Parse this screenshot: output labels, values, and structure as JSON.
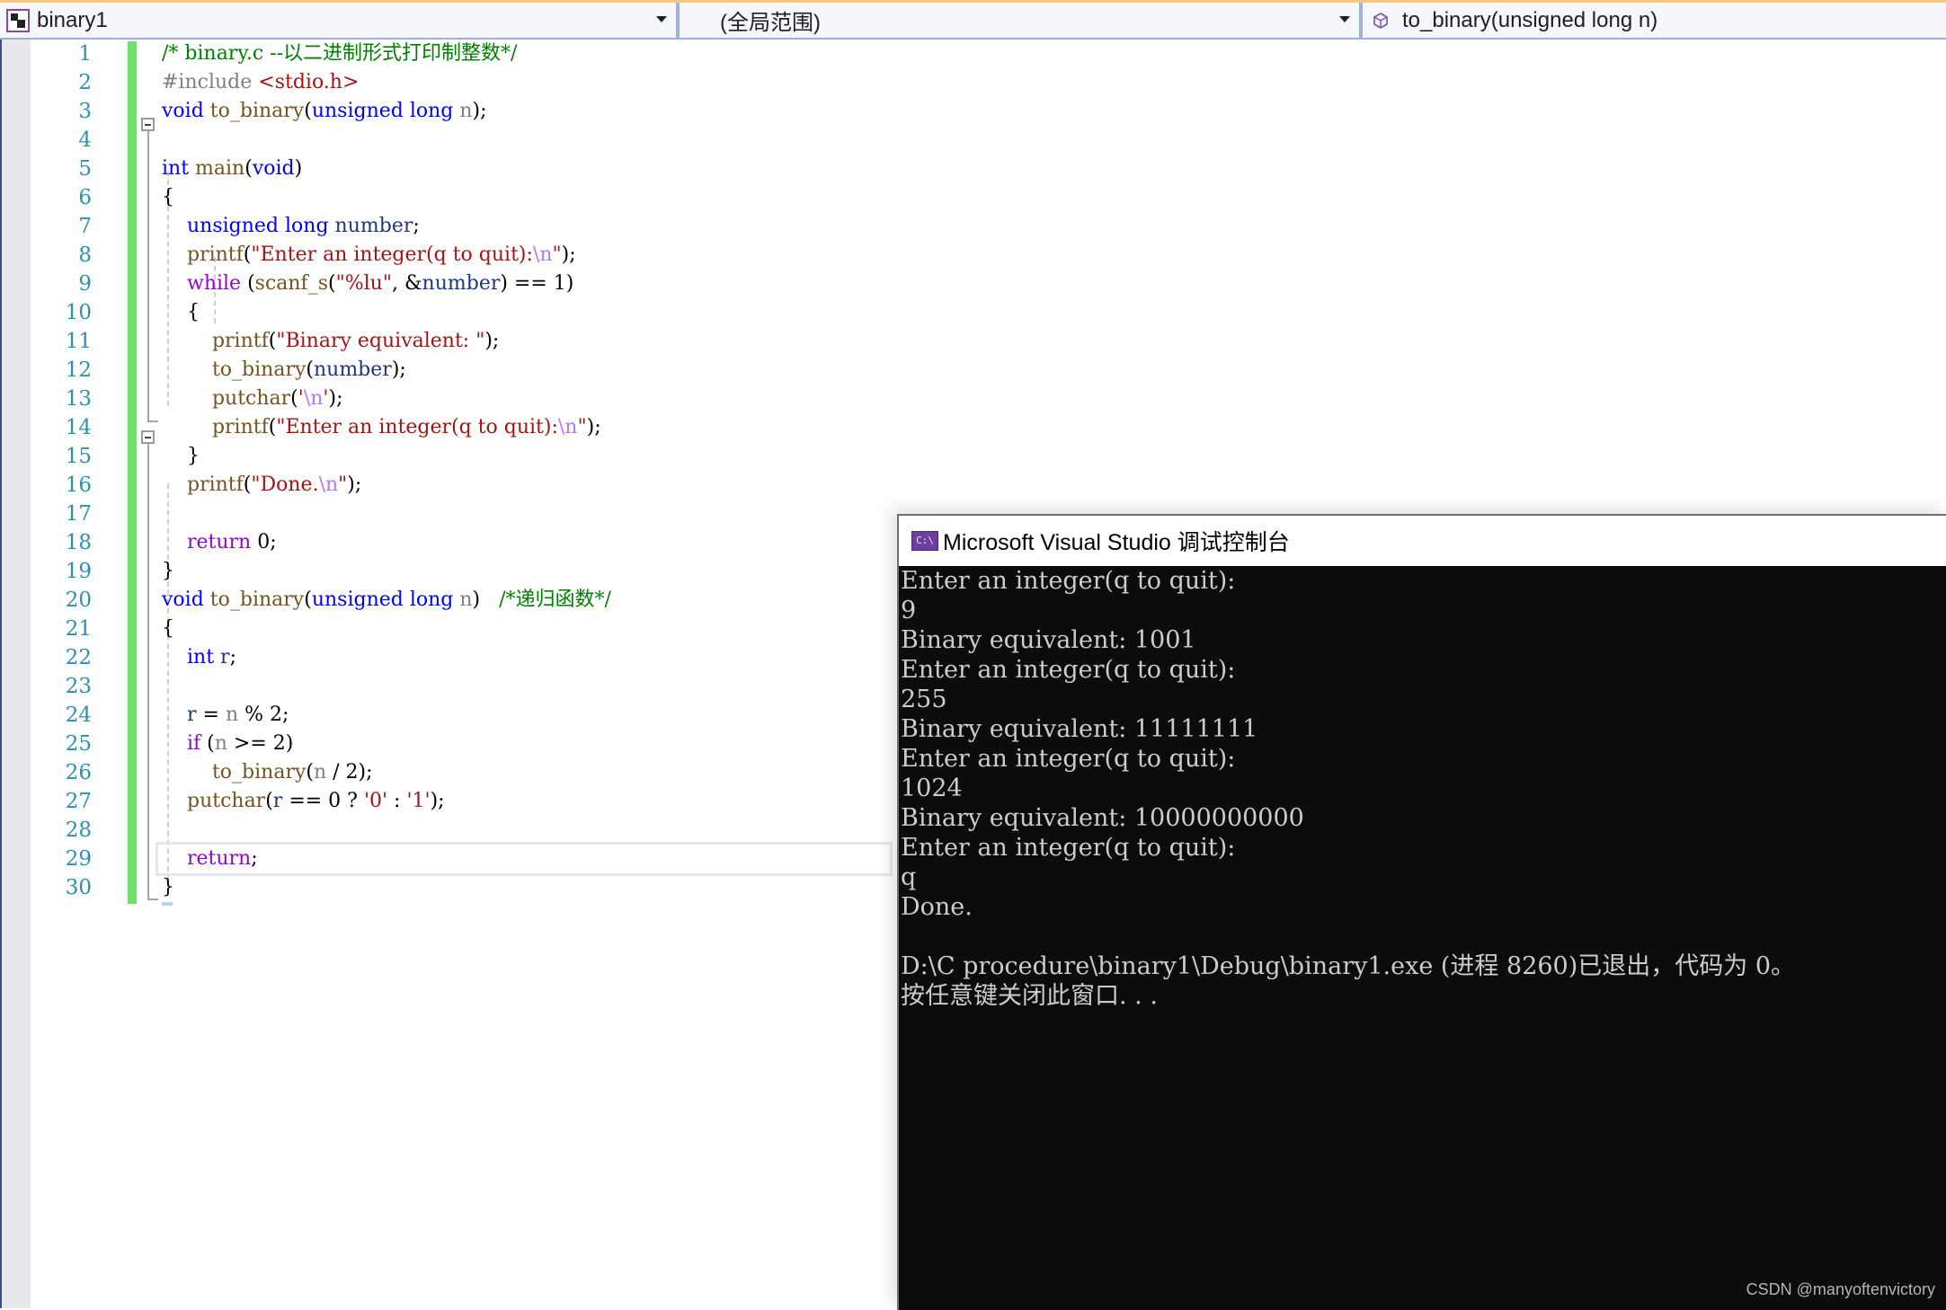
{
  "navbar": {
    "project": "binary1",
    "scope": "(全局范围)",
    "function": "to_binary(unsigned long n)",
    "project_icon": "vc-project-icon",
    "function_icon": "function-cube-icon"
  },
  "editor": {
    "line_numbers": [
      "1",
      "2",
      "3",
      "4",
      "5",
      "6",
      "7",
      "8",
      "9",
      "10",
      "11",
      "12",
      "13",
      "14",
      "15",
      "16",
      "17",
      "18",
      "19",
      "20",
      "21",
      "22",
      "23",
      "24",
      "25",
      "26",
      "27",
      "28",
      "29",
      "30"
    ],
    "current_line": 29,
    "lines": [
      [
        {
          "t": "cmt",
          "v": "/* binary.c --以二进制形式打印制整数*/"
        }
      ],
      [
        {
          "t": "pp",
          "v": "#include "
        },
        {
          "t": "inc",
          "v": "<stdio.h>"
        }
      ],
      [
        {
          "t": "kw",
          "v": "void"
        },
        {
          "t": "",
          "v": " "
        },
        {
          "t": "fn",
          "v": "to_binary"
        },
        {
          "t": "",
          "v": "("
        },
        {
          "t": "kw",
          "v": "unsigned long"
        },
        {
          "t": "",
          "v": " "
        },
        {
          "t": "param",
          "v": "n"
        },
        {
          "t": "",
          "v": ");"
        }
      ],
      [],
      [
        {
          "t": "kw",
          "v": "int"
        },
        {
          "t": "",
          "v": " "
        },
        {
          "t": "fn",
          "v": "main"
        },
        {
          "t": "",
          "v": "("
        },
        {
          "t": "kw",
          "v": "void"
        },
        {
          "t": "",
          "v": ")"
        }
      ],
      [
        {
          "t": "",
          "v": "{"
        }
      ],
      [
        {
          "t": "",
          "v": "    "
        },
        {
          "t": "kw",
          "v": "unsigned long"
        },
        {
          "t": "",
          "v": " "
        },
        {
          "t": "var",
          "v": "number"
        },
        {
          "t": "",
          "v": ";"
        }
      ],
      [
        {
          "t": "",
          "v": "    "
        },
        {
          "t": "fn",
          "v": "printf"
        },
        {
          "t": "",
          "v": "("
        },
        {
          "t": "str",
          "v": "\"Enter an integer(q to quit):"
        },
        {
          "t": "esc",
          "v": "\\n"
        },
        {
          "t": "str",
          "v": "\""
        },
        {
          "t": "",
          "v": ");"
        }
      ],
      [
        {
          "t": "",
          "v": "    "
        },
        {
          "t": "ctl",
          "v": "while"
        },
        {
          "t": "",
          "v": " ("
        },
        {
          "t": "fn",
          "v": "scanf_s"
        },
        {
          "t": "",
          "v": "("
        },
        {
          "t": "str",
          "v": "\"%lu\""
        },
        {
          "t": "",
          "v": ", &"
        },
        {
          "t": "var",
          "v": "number"
        },
        {
          "t": "",
          "v": ") == 1)"
        }
      ],
      [
        {
          "t": "",
          "v": "    {"
        }
      ],
      [
        {
          "t": "",
          "v": "        "
        },
        {
          "t": "fn",
          "v": "printf"
        },
        {
          "t": "",
          "v": "("
        },
        {
          "t": "str",
          "v": "\"Binary equivalent: \""
        },
        {
          "t": "",
          "v": ");"
        }
      ],
      [
        {
          "t": "",
          "v": "        "
        },
        {
          "t": "fn",
          "v": "to_binary"
        },
        {
          "t": "",
          "v": "("
        },
        {
          "t": "var",
          "v": "number"
        },
        {
          "t": "",
          "v": ");"
        }
      ],
      [
        {
          "t": "",
          "v": "        "
        },
        {
          "t": "fn",
          "v": "putchar"
        },
        {
          "t": "",
          "v": "("
        },
        {
          "t": "str",
          "v": "'"
        },
        {
          "t": "esc",
          "v": "\\n"
        },
        {
          "t": "str",
          "v": "'"
        },
        {
          "t": "",
          "v": ");"
        }
      ],
      [
        {
          "t": "",
          "v": "        "
        },
        {
          "t": "fn",
          "v": "printf"
        },
        {
          "t": "",
          "v": "("
        },
        {
          "t": "str",
          "v": "\"Enter an integer(q to quit):"
        },
        {
          "t": "esc",
          "v": "\\n"
        },
        {
          "t": "str",
          "v": "\""
        },
        {
          "t": "",
          "v": ");"
        }
      ],
      [
        {
          "t": "",
          "v": "    }"
        }
      ],
      [
        {
          "t": "",
          "v": "    "
        },
        {
          "t": "fn",
          "v": "printf"
        },
        {
          "t": "",
          "v": "("
        },
        {
          "t": "str",
          "v": "\"Done."
        },
        {
          "t": "esc",
          "v": "\\n"
        },
        {
          "t": "str",
          "v": "\""
        },
        {
          "t": "",
          "v": ");"
        }
      ],
      [],
      [
        {
          "t": "",
          "v": "    "
        },
        {
          "t": "ctl",
          "v": "return"
        },
        {
          "t": "",
          "v": " 0;"
        }
      ],
      [
        {
          "t": "",
          "v": "}"
        }
      ],
      [
        {
          "t": "kw",
          "v": "void"
        },
        {
          "t": "",
          "v": " "
        },
        {
          "t": "fn",
          "v": "to_binary"
        },
        {
          "t": "",
          "v": "("
        },
        {
          "t": "kw",
          "v": "unsigned long"
        },
        {
          "t": "",
          "v": " "
        },
        {
          "t": "param",
          "v": "n"
        },
        {
          "t": "",
          "v": ")   "
        },
        {
          "t": "cmt",
          "v": "/*递归函数*/"
        }
      ],
      [
        {
          "t": "",
          "v": "{"
        }
      ],
      [
        {
          "t": "",
          "v": "    "
        },
        {
          "t": "kw",
          "v": "int"
        },
        {
          "t": "",
          "v": " "
        },
        {
          "t": "var",
          "v": "r"
        },
        {
          "t": "",
          "v": ";"
        }
      ],
      [],
      [
        {
          "t": "",
          "v": "    "
        },
        {
          "t": "var",
          "v": "r"
        },
        {
          "t": "",
          "v": " = "
        },
        {
          "t": "param",
          "v": "n"
        },
        {
          "t": "",
          "v": " % 2;"
        }
      ],
      [
        {
          "t": "",
          "v": "    "
        },
        {
          "t": "ctl",
          "v": "if"
        },
        {
          "t": "",
          "v": " ("
        },
        {
          "t": "param",
          "v": "n"
        },
        {
          "t": "",
          "v": " >= 2)"
        }
      ],
      [
        {
          "t": "",
          "v": "        "
        },
        {
          "t": "fn",
          "v": "to_binary"
        },
        {
          "t": "",
          "v": "("
        },
        {
          "t": "param",
          "v": "n"
        },
        {
          "t": "",
          "v": " / 2);"
        }
      ],
      [
        {
          "t": "",
          "v": "    "
        },
        {
          "t": "fn",
          "v": "putchar"
        },
        {
          "t": "",
          "v": "("
        },
        {
          "t": "var",
          "v": "r"
        },
        {
          "t": "",
          "v": " == 0 ? "
        },
        {
          "t": "str",
          "v": "'0'"
        },
        {
          "t": "",
          "v": " : "
        },
        {
          "t": "str",
          "v": "'1'"
        },
        {
          "t": "",
          "v": ");"
        }
      ],
      [],
      [
        {
          "t": "",
          "v": "    "
        },
        {
          "t": "ctl",
          "v": "return"
        },
        {
          "t": "",
          "v": ";"
        }
      ],
      [
        {
          "t": "",
          "v": "}"
        }
      ]
    ]
  },
  "console": {
    "title": "Microsoft Visual Studio 调试控制台",
    "icon_label": "C:\\",
    "output": [
      "Enter an integer(q to quit):",
      "9",
      "Binary equivalent: 1001",
      "Enter an integer(q to quit):",
      "255",
      "Binary equivalent: 11111111",
      "Enter an integer(q to quit):",
      "1024",
      "Binary equivalent: 10000000000",
      "Enter an integer(q to quit):",
      "q",
      "Done.",
      "",
      "D:\\C procedure\\binary1\\Debug\\binary1.exe (进程 8260)已退出，代码为 0。",
      "按任意键关闭此窗口. . ."
    ]
  },
  "watermark": "CSDN @manyoftenvictory"
}
